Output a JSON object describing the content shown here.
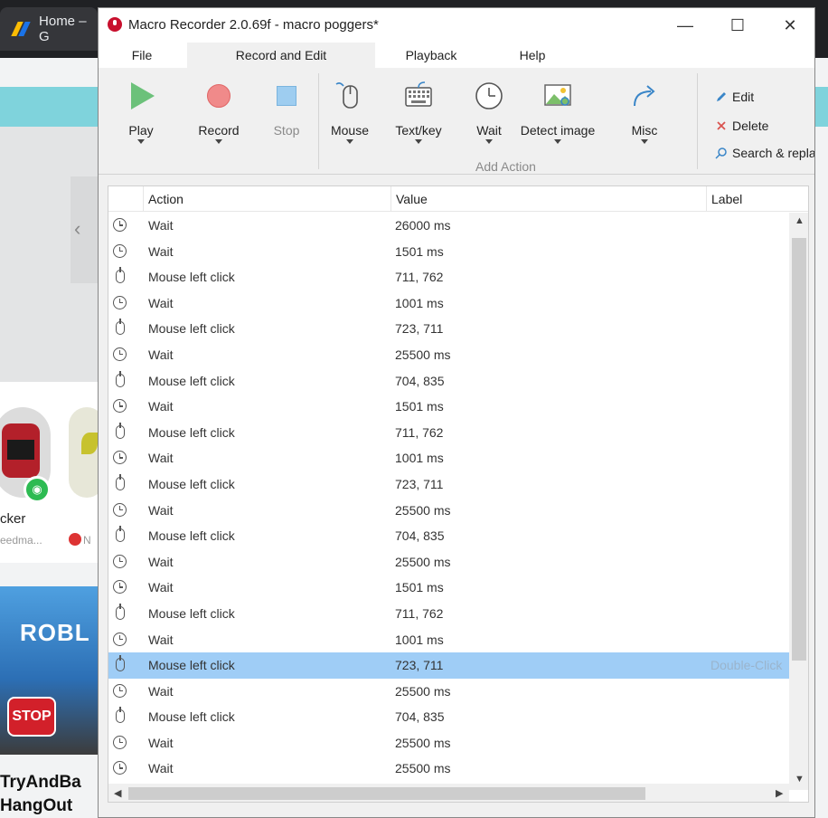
{
  "browser": {
    "tab_title": "Home – G",
    "bg_user_name": "cker",
    "bg_user_sub": "eedma...",
    "bg_mark_text": "N",
    "game_logo": "ROBL",
    "stop_sign": "STOP",
    "game_title_line1": "TryAndBa",
    "game_title_line2": "HangOut"
  },
  "window": {
    "title": "Macro Recorder 2.0.69f - macro poggers*",
    "minimize": "—",
    "maximize": "☐",
    "close": "✕"
  },
  "menu": {
    "items": [
      "File",
      "Record and Edit",
      "Playback",
      "Help"
    ]
  },
  "ribbon": {
    "play": "Play",
    "record": "Record",
    "stop": "Stop",
    "mouse": "Mouse",
    "textkey": "Text/key",
    "wait": "Wait",
    "detect": "Detect image",
    "misc": "Misc",
    "group_label": "Add Action",
    "edit": "Edit",
    "delete": "Delete",
    "search": "Search & repla"
  },
  "table": {
    "headers": [
      "Action",
      "Value",
      "Label"
    ],
    "rows": [
      {
        "icon": "clock-icon",
        "action": "Wait",
        "value": "26000 ms",
        "label": ""
      },
      {
        "icon": "clock-icon",
        "action": "Wait",
        "value": "1501 ms",
        "label": ""
      },
      {
        "icon": "mouse-icon",
        "action": "Mouse left click",
        "value": "711, 762",
        "label": ""
      },
      {
        "icon": "clock-icon",
        "action": "Wait",
        "value": "1001 ms",
        "label": ""
      },
      {
        "icon": "mouse-icon",
        "action": "Mouse left click",
        "value": "723, 711",
        "label": ""
      },
      {
        "icon": "clock-icon",
        "action": "Wait",
        "value": "25500 ms",
        "label": ""
      },
      {
        "icon": "mouse-icon",
        "action": "Mouse left click",
        "value": "704, 835",
        "label": ""
      },
      {
        "icon": "clock-icon",
        "action": "Wait",
        "value": "1501 ms",
        "label": ""
      },
      {
        "icon": "mouse-icon",
        "action": "Mouse left click",
        "value": "711, 762",
        "label": ""
      },
      {
        "icon": "clock-icon",
        "action": "Wait",
        "value": "1001 ms",
        "label": ""
      },
      {
        "icon": "mouse-icon",
        "action": "Mouse left click",
        "value": "723, 711",
        "label": ""
      },
      {
        "icon": "clock-icon",
        "action": "Wait",
        "value": "25500 ms",
        "label": ""
      },
      {
        "icon": "mouse-icon",
        "action": "Mouse left click",
        "value": "704, 835",
        "label": ""
      },
      {
        "icon": "clock-icon",
        "action": "Wait",
        "value": "25500 ms",
        "label": ""
      },
      {
        "icon": "clock-icon",
        "action": "Wait",
        "value": "1501 ms",
        "label": ""
      },
      {
        "icon": "mouse-icon",
        "action": "Mouse left click",
        "value": "711, 762",
        "label": ""
      },
      {
        "icon": "clock-icon",
        "action": "Wait",
        "value": "1001 ms",
        "label": ""
      },
      {
        "icon": "mouse-icon",
        "action": "Mouse left click",
        "value": "723, 711",
        "label": "Double-Click",
        "selected": true
      },
      {
        "icon": "clock-icon",
        "action": "Wait",
        "value": "25500 ms",
        "label": ""
      },
      {
        "icon": "mouse-icon",
        "action": "Mouse left click",
        "value": "704, 835",
        "label": ""
      },
      {
        "icon": "clock-icon",
        "action": "Wait",
        "value": "25500 ms",
        "label": ""
      },
      {
        "icon": "clock-icon",
        "action": "Wait",
        "value": "25500 ms",
        "label": ""
      }
    ]
  },
  "colors": {
    "selection": "#9fcdf6",
    "play": "#6cc17a",
    "record": "#f08a8a",
    "stop": "#9ecdf0"
  }
}
